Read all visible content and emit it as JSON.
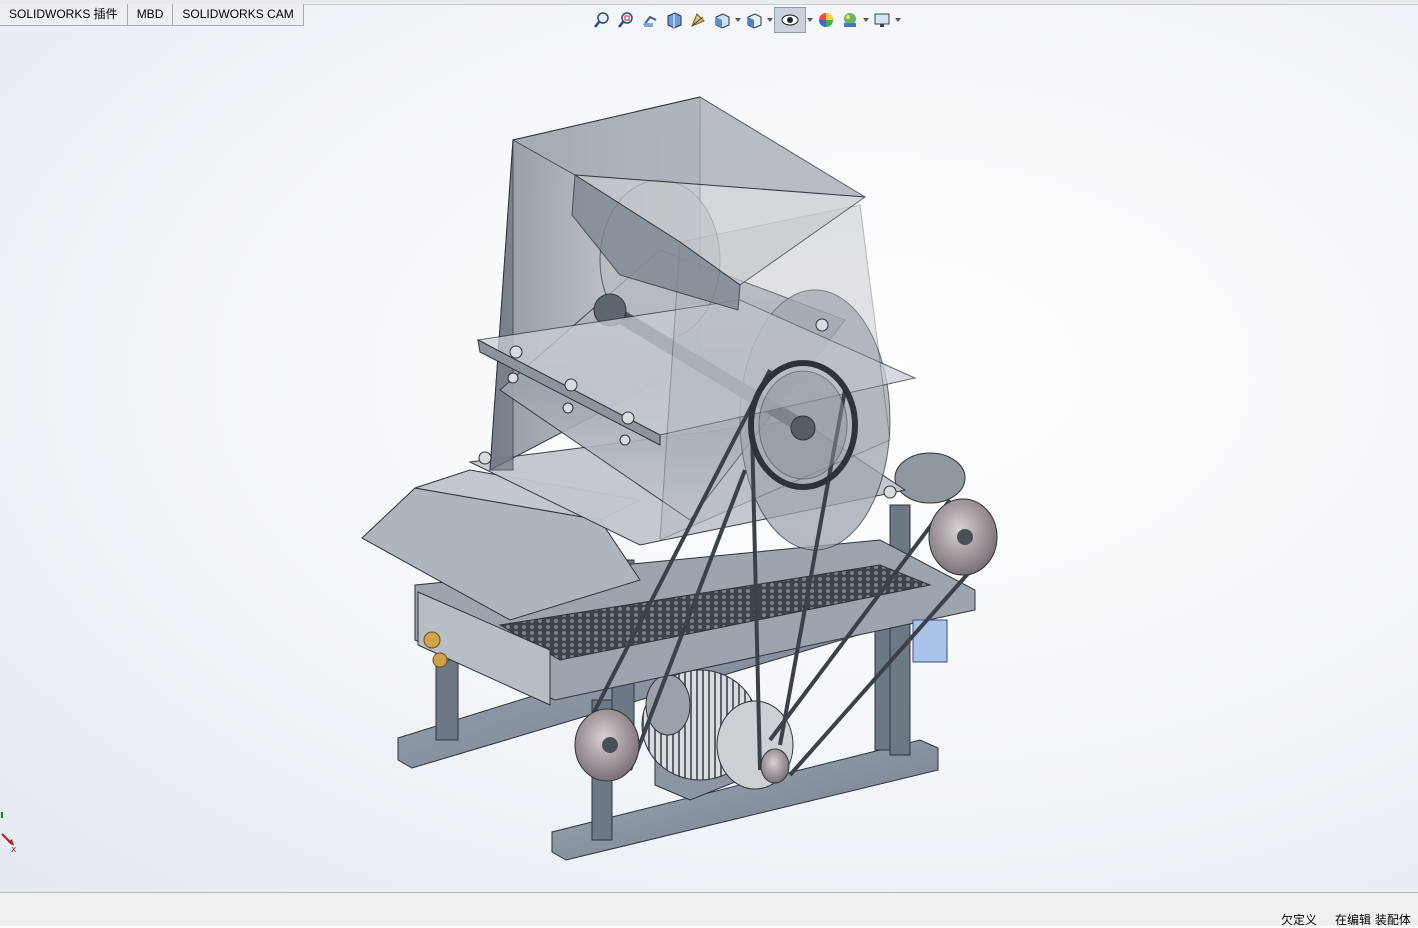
{
  "tabs": [
    "SOLIDWORKS 插件",
    "MBD",
    "SOLIDWORKS CAM"
  ],
  "toolbar": {
    "icons": [
      "zoom-to-fit-icon",
      "zoom-to-area-icon",
      "previous-view-icon",
      "section-view-icon",
      "dynamic-annotation-views-icon",
      "view-orientation-icon",
      "display-style-icon",
      "hide-show-items-icon",
      "edit-appearance-icon",
      "apply-scene-icon",
      "view-settings-icon"
    ]
  },
  "triad": {
    "x_label": "x"
  },
  "status": {
    "definition": "欠定义",
    "mode": "在编辑 装配体"
  },
  "colors": {
    "viewport_center": "#ffffff",
    "viewport_edge": "#e4e9f1",
    "frame": "#7d8895",
    "glass": "#9aa1ab",
    "pulley": "#8a7e86"
  }
}
